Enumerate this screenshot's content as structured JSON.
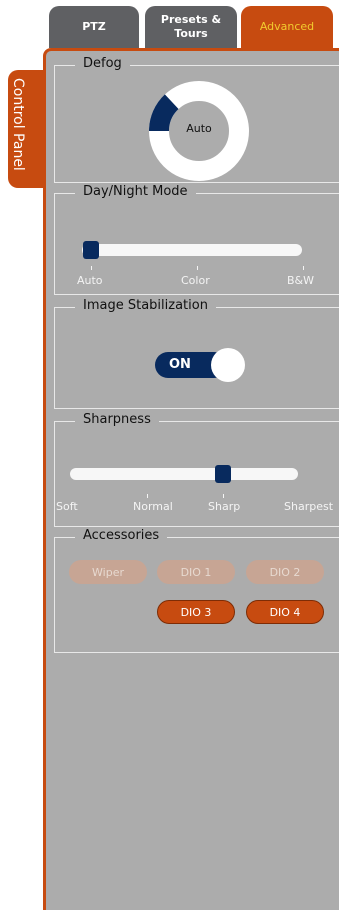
{
  "tabs": {
    "ptz": "PTZ",
    "presets_line1": "Presets &",
    "presets_line2": "Tours",
    "advanced": "Advanced"
  },
  "side_tab": "Control Panel",
  "defog": {
    "title": "Defog",
    "center_label": "Auto"
  },
  "day_night": {
    "title": "Day/Night Mode",
    "options": [
      "Auto",
      "Color",
      "B&W"
    ],
    "selected": "Auto"
  },
  "stabilization": {
    "title": "Image Stabilization",
    "toggle_label": "ON"
  },
  "sharpness": {
    "title": "Sharpness",
    "options": [
      "Soft",
      "Normal",
      "Sharp",
      "Sharpest"
    ],
    "selected": "Sharp"
  },
  "accessories": {
    "title": "Accessories",
    "buttons": [
      {
        "label": "Wiper",
        "active": false
      },
      {
        "label": "DIO 1",
        "active": false
      },
      {
        "label": "DIO 2",
        "active": false
      },
      {
        "label": "DIO 3",
        "active": true
      },
      {
        "label": "DIO 4",
        "active": true
      }
    ]
  },
  "colors": {
    "accent": "#c74b10",
    "active_tab_text": "#f2cb2e",
    "thumb": "#082a5e",
    "panel_bg": "#acacac"
  }
}
